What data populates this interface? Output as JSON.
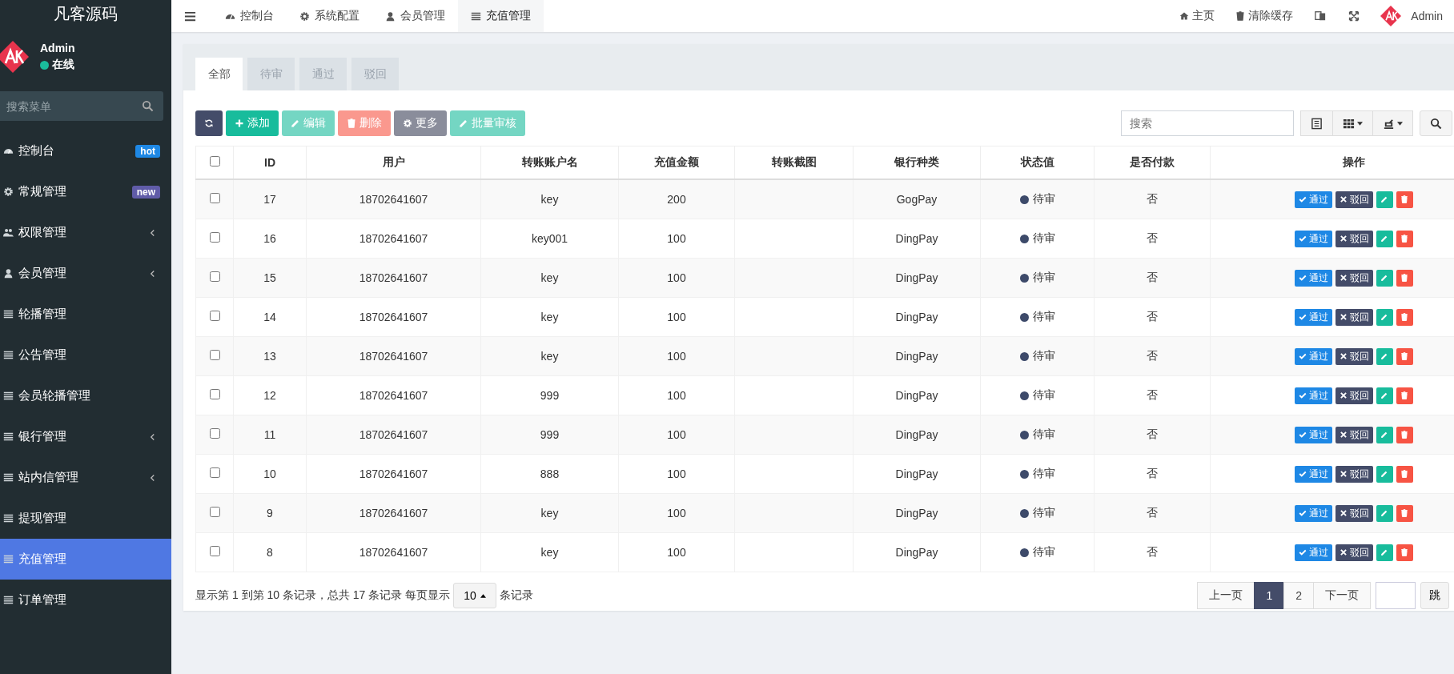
{
  "brand": "凡客源码",
  "user": {
    "name": "Admin",
    "status": "在线",
    "online": true
  },
  "menu_search": {
    "placeholder": "搜索菜单"
  },
  "sidebar": {
    "items": [
      {
        "label": "控制台",
        "badge": {
          "text": "hot",
          "color": "#1e88e5"
        },
        "expandable": false,
        "selected": false
      },
      {
        "label": "常规管理",
        "badge": {
          "text": "new",
          "color": "#605ca8"
        },
        "expandable": false,
        "selected": false
      },
      {
        "label": "权限管理",
        "expandable": true,
        "selected": false
      },
      {
        "label": "会员管理",
        "expandable": true,
        "selected": false
      },
      {
        "label": "轮播管理",
        "expandable": false,
        "selected": false
      },
      {
        "label": "公告管理",
        "expandable": false,
        "selected": false
      },
      {
        "label": "会员轮播管理",
        "expandable": false,
        "selected": false
      },
      {
        "label": "银行管理",
        "expandable": true,
        "selected": false
      },
      {
        "label": "站内信管理",
        "expandable": true,
        "selected": false
      },
      {
        "label": "提现管理",
        "expandable": false,
        "selected": false
      },
      {
        "label": "充值管理",
        "expandable": false,
        "selected": true
      },
      {
        "label": "订单管理",
        "expandable": false,
        "selected": false
      }
    ]
  },
  "topnav": {
    "tabs": [
      {
        "label": "控制台",
        "selected": false
      },
      {
        "label": "系统配置",
        "selected": false
      },
      {
        "label": "会员管理",
        "selected": false
      },
      {
        "label": "充值管理",
        "selected": true
      }
    ],
    "links": [
      "主页",
      "清除缓存"
    ],
    "admin": "Admin"
  },
  "tabs": [
    {
      "label": "全部",
      "selected": true
    },
    {
      "label": "待审",
      "selected": false
    },
    {
      "label": "通过",
      "selected": false
    },
    {
      "label": "驳回",
      "selected": false
    }
  ],
  "toolbar": {
    "buttons": [
      {
        "kind": "refresh",
        "disabled": false
      },
      {
        "kind": "add",
        "label": "添加",
        "disabled": false
      },
      {
        "kind": "edit",
        "label": "编辑",
        "disabled": true
      },
      {
        "kind": "delete",
        "label": "删除",
        "disabled": true
      },
      {
        "kind": "more",
        "label": "更多",
        "disabled": false
      },
      {
        "kind": "audit",
        "label": "批量审核",
        "disabled": true
      }
    ],
    "search": {
      "placeholder": "搜索"
    }
  },
  "table": {
    "columns": [
      "ID",
      "用户",
      "转账账户名",
      "充值金额",
      "转账截图",
      "银行种类",
      "状态值",
      "是否付款",
      "操作"
    ],
    "all_checked": false,
    "rows": [
      {
        "checked": false,
        "id": "17",
        "user": "18702641607",
        "account": "key",
        "amount": "200",
        "bank": "GogPay",
        "status": "待审",
        "paid": "否",
        "approve": "通过",
        "reject": "驳回"
      },
      {
        "checked": false,
        "id": "16",
        "user": "18702641607",
        "account": "key001",
        "amount": "100",
        "bank": "DingPay",
        "status": "待审",
        "paid": "否",
        "approve": "通过",
        "reject": "驳回"
      },
      {
        "checked": false,
        "id": "15",
        "user": "18702641607",
        "account": "key",
        "amount": "100",
        "bank": "DingPay",
        "status": "待审",
        "paid": "否",
        "approve": "通过",
        "reject": "驳回"
      },
      {
        "checked": false,
        "id": "14",
        "user": "18702641607",
        "account": "key",
        "amount": "100",
        "bank": "DingPay",
        "status": "待审",
        "paid": "否",
        "approve": "通过",
        "reject": "驳回"
      },
      {
        "checked": false,
        "id": "13",
        "user": "18702641607",
        "account": "key",
        "amount": "100",
        "bank": "DingPay",
        "status": "待审",
        "paid": "否",
        "approve": "通过",
        "reject": "驳回"
      },
      {
        "checked": false,
        "id": "12",
        "user": "18702641607",
        "account": "999",
        "amount": "100",
        "bank": "DingPay",
        "status": "待审",
        "paid": "否",
        "approve": "通过",
        "reject": "驳回"
      },
      {
        "checked": false,
        "id": "11",
        "user": "18702641607",
        "account": "999",
        "amount": "100",
        "bank": "DingPay",
        "status": "待审",
        "paid": "否",
        "approve": "通过",
        "reject": "驳回"
      },
      {
        "checked": false,
        "id": "10",
        "user": "18702641607",
        "account": "888",
        "amount": "100",
        "bank": "DingPay",
        "status": "待审",
        "paid": "否",
        "approve": "通过",
        "reject": "驳回"
      },
      {
        "checked": false,
        "id": "9",
        "user": "18702641607",
        "account": "key",
        "amount": "100",
        "bank": "DingPay",
        "status": "待审",
        "paid": "否",
        "approve": "通过",
        "reject": "驳回"
      },
      {
        "checked": false,
        "id": "8",
        "user": "18702641607",
        "account": "key",
        "amount": "100",
        "bank": "DingPay",
        "status": "待审",
        "paid": "否",
        "approve": "通过",
        "reject": "驳回"
      }
    ]
  },
  "footer": {
    "summary": "显示第 1 到第 10 条记录，总共 17 条记录 每页显示",
    "page_size": "10",
    "suffix": "条记录",
    "prev": "上一页",
    "pages": [
      {
        "label": "1",
        "selected": true
      },
      {
        "label": "2",
        "selected": false
      }
    ],
    "next": "下一页",
    "jump": "跳"
  }
}
